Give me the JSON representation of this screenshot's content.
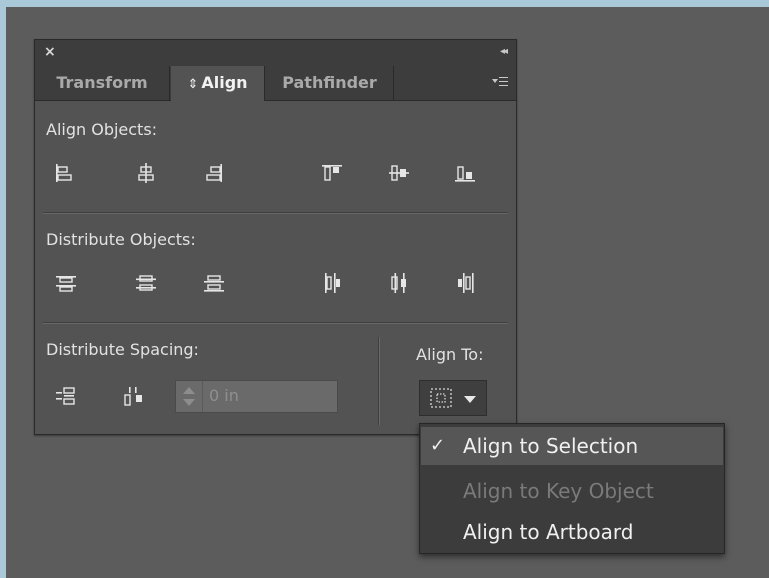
{
  "panel": {
    "close_glyph": "×",
    "collapse_glyph": "◂◂",
    "tabs": [
      {
        "label": "Transform"
      },
      {
        "label": "Align",
        "prefix_glyph": "⇕"
      },
      {
        "label": "Pathfinder"
      }
    ],
    "panel_menu_icon": "flyout-menu-icon",
    "align_objects_label": "Align Objects:",
    "align_objects_icons": [
      "horizontal-align-left-icon",
      "horizontal-align-center-icon",
      "horizontal-align-right-icon",
      "vertical-align-top-icon",
      "vertical-align-center-icon",
      "vertical-align-bottom-icon"
    ],
    "distribute_objects_label": "Distribute Objects:",
    "distribute_objects_icons": [
      "vertical-distribute-top-icon",
      "vertical-distribute-center-icon",
      "vertical-distribute-bottom-icon",
      "horizontal-distribute-left-icon",
      "horizontal-distribute-center-icon",
      "horizontal-distribute-right-icon"
    ],
    "distribute_spacing_label": "Distribute Spacing:",
    "distribute_spacing_icons": [
      "vertical-distribute-space-icon",
      "horizontal-distribute-space-icon"
    ],
    "spacing_value": "0 in",
    "align_to_label": "Align To:",
    "align_to_icon": "align-to-selection-icon"
  },
  "dropdown": {
    "items": [
      {
        "label": "Align to Selection",
        "checked": true,
        "check_glyph": "✓"
      },
      {
        "label": "Align to Key Object",
        "disabled": true
      },
      {
        "label": "Align to Artboard"
      }
    ]
  },
  "colors": {
    "page_border": "#a9c9d9",
    "workspace": "#5c5c5c",
    "panel_bg": "#535353",
    "tab_bar": "#3d3d3d",
    "menu_bg": "#3c3c3c",
    "menu_highlight": "#565656"
  }
}
